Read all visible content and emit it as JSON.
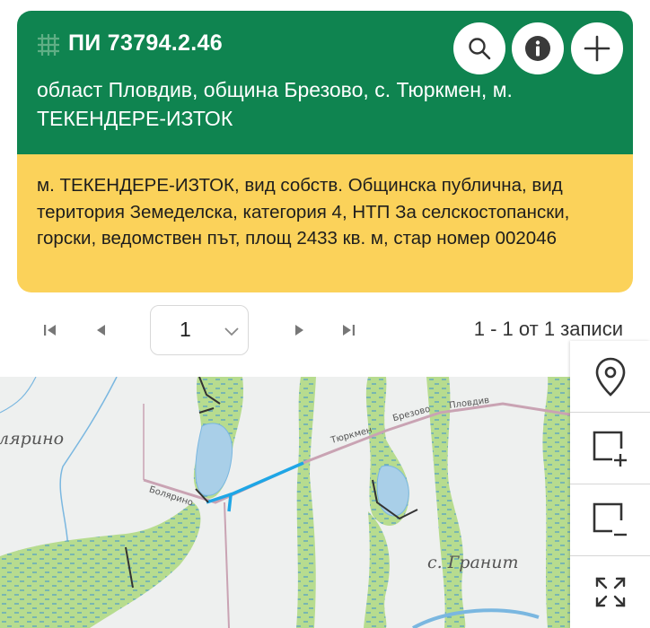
{
  "parcel": {
    "title": "ПИ 73794.2.46",
    "address": "област Пловдив, община Брезово, с. Тюркмен, м. ТЕКЕНДЕРЕ-ИЗТОК",
    "description": "м. ТЕКЕНДЕРЕ-ИЗТОК, вид собств. Общинска публична, вид територия Земеделска, категория 4, НТП За селскостопански, горски, ведомствен път, площ 2433 кв. м, стар номер 002046"
  },
  "actions": {
    "search_icon": "search-icon",
    "info_icon": "info-icon",
    "add_icon": "plus-icon"
  },
  "pager": {
    "current_page": "1",
    "records_info": "1 - 1 от 1 записи"
  },
  "map": {
    "village_left": "лярино",
    "village_right": "с. Гранит",
    "road_label_1": "Тюркмен",
    "road_label_2": "Брезово",
    "road_label_3": "Пловдив",
    "road_label_4": "Болярино"
  },
  "tools": [
    "location-pin-icon",
    "add-area-icon",
    "remove-area-icon",
    "fullscreen-icon"
  ],
  "colors": {
    "header_green": "#0f8450",
    "info_yellow": "#fbd25a",
    "highlight_blue": "#1ea6e6"
  }
}
